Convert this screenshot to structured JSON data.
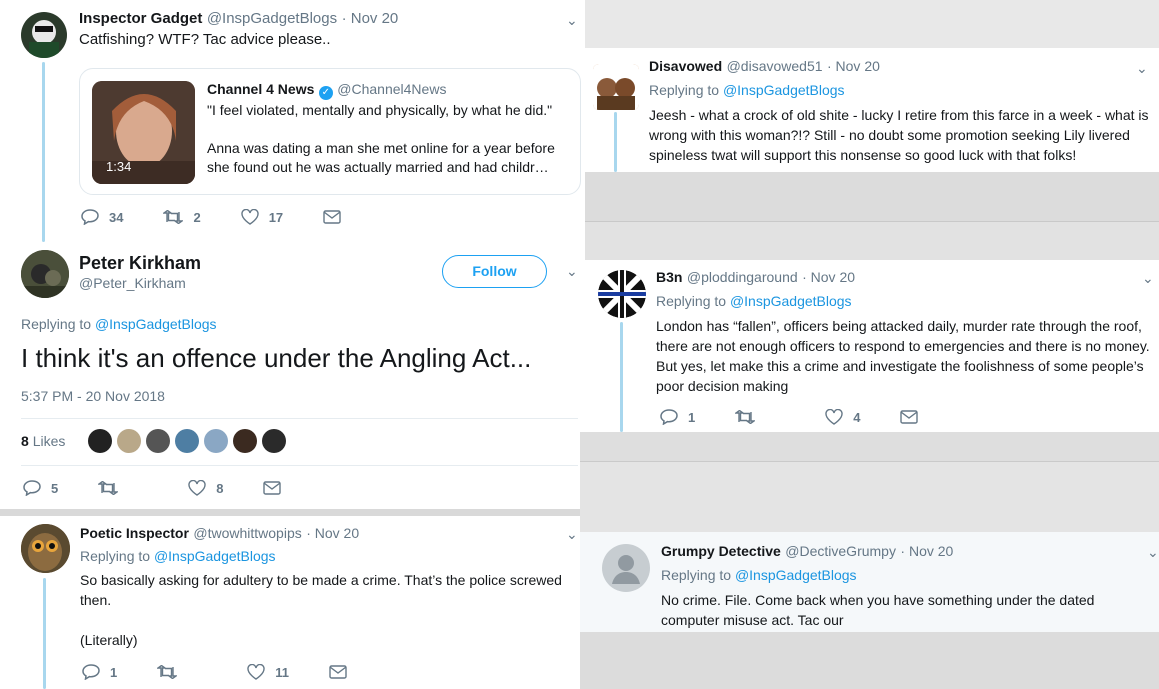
{
  "left": {
    "tweet1": {
      "name": "Inspector Gadget",
      "handle": "@InspGadgetBlogs",
      "date": "· Nov 20",
      "text": "Catfishing? WTF? Tac advice please..",
      "card": {
        "source_name": "Channel 4 News",
        "source_handle": "@Channel4News",
        "duration": "1:34",
        "quote": "\"I feel violated, mentally and physically, by what he did.\"",
        "body": "Anna was dating a man she met online for a year before she found out he was actually married and had childr…"
      },
      "replies": "34",
      "retweets": "2",
      "likes": "17"
    },
    "main": {
      "name": "Peter Kirkham",
      "handle": "@Peter_Kirkham",
      "follow_label": "Follow",
      "replying_label": "Replying to",
      "replying_handle": "@InspGadgetBlogs",
      "text": "I think it's an offence under the Angling Act...",
      "timestamp": "5:37 PM - 20 Nov 2018",
      "likes_count": "8",
      "likes_label": "Likes",
      "replies": "5",
      "retweets": "",
      "likes": "8"
    },
    "tweet3": {
      "name": "Poetic Inspector",
      "handle": "@twowhittwopips",
      "date": "· Nov 20",
      "replying_label": "Replying to",
      "replying_handle": "@InspGadgetBlogs",
      "text1": "So basically asking for adultery to be made a crime. That’s the police screwed then.",
      "text2": "(Literally)",
      "replies": "1",
      "retweets": "",
      "likes": "11"
    }
  },
  "right": {
    "disavowed": {
      "name": "Disavowed",
      "handle": "@disavowed51",
      "date": "· Nov 20",
      "replying_label": "Replying to",
      "replying_handle": "@InspGadgetBlogs",
      "text": "Jeesh - what a crock of old shite - lucky I retire from this farce in a week - what is wrong with this woman?!? Still - no doubt some promotion seeking Lily livered spineless twat will support this nonsense so good luck with that folks!"
    },
    "b3n": {
      "name": "B3n",
      "handle": "@ploddingaround",
      "date": "· Nov 20",
      "replying_label": "Replying to",
      "replying_handle": "@InspGadgetBlogs",
      "text": "London has “fallen”, officers being attacked daily, murder rate through the roof, there are not enough officers to respond to emergencies and there is no money. But yes, let make this a crime and investigate the foolishness of some people’s poor decision making",
      "replies": "1",
      "retweets": "",
      "likes": "4"
    },
    "grumpy": {
      "name": "Grumpy Detective",
      "handle": "@DectiveGrumpy",
      "date": "· Nov 20",
      "replying_label": "Replying to",
      "replying_handle": "@InspGadgetBlogs",
      "text": "No crime. File. Come back when you have something under the dated computer misuse act. Tac our"
    }
  },
  "colors": {
    "accent": "#1b95e0",
    "thread": "#a8d7ee",
    "muted": "#657786"
  }
}
